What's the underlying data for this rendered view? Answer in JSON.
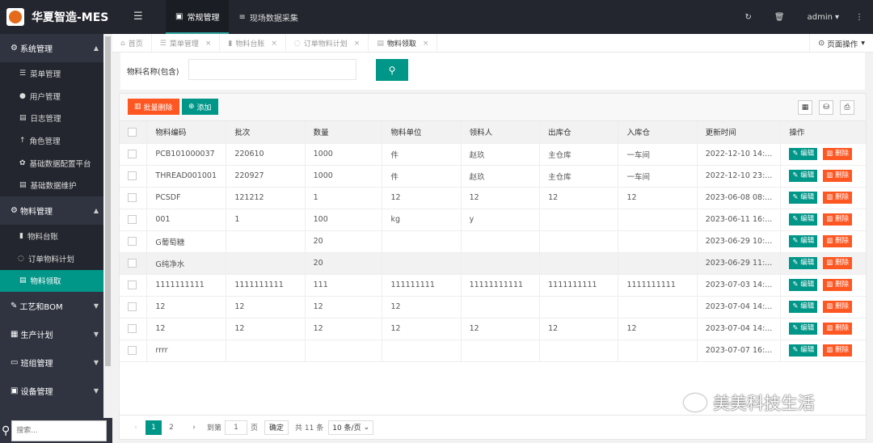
{
  "app": {
    "title": "华夏智造-MES"
  },
  "topnav": [
    {
      "label": "常规管理",
      "active": true
    },
    {
      "label": "现场数据采集",
      "active": false
    }
  ],
  "user": {
    "name": "admin"
  },
  "sidebar": {
    "groups": [
      {
        "label": "系统管理",
        "open": true,
        "items": [
          {
            "label": "菜单管理"
          },
          {
            "label": "用户管理"
          },
          {
            "label": "日志管理"
          },
          {
            "label": "角色管理"
          },
          {
            "label": "基础数据配置平台"
          },
          {
            "label": "基础数据维护"
          }
        ]
      },
      {
        "label": "物料管理",
        "open": true,
        "items": [
          {
            "label": "物料台账"
          },
          {
            "label": "订单物料计划"
          },
          {
            "label": "物料领取",
            "active": true
          }
        ]
      },
      {
        "label": "工艺和BOM",
        "open": false,
        "items": []
      },
      {
        "label": "生产计划",
        "open": false,
        "items": []
      },
      {
        "label": "班组管理",
        "open": false,
        "items": []
      },
      {
        "label": "设备管理",
        "open": false,
        "items": []
      }
    ],
    "search_placeholder": "搜索..."
  },
  "tabs": [
    {
      "label": "首页",
      "closable": false
    },
    {
      "label": "菜单管理",
      "closable": true
    },
    {
      "label": "物料台账",
      "closable": true
    },
    {
      "label": "订单物料计划",
      "closable": true
    },
    {
      "label": "物料领取",
      "closable": true,
      "active": true
    }
  ],
  "page_ops": "页面操作",
  "search": {
    "label": "物料名称(包含)",
    "value": ""
  },
  "toolbar": {
    "batch_delete": "批量删除",
    "add": "添加"
  },
  "table": {
    "columns": [
      "物料编码",
      "批次",
      "数量",
      "物料单位",
      "领料人",
      "出库仓",
      "入库仓",
      "更新时间",
      "操作"
    ],
    "rows": [
      [
        "PCB101000037",
        "220610",
        "1000",
        "件",
        "赵玖",
        "主仓库",
        "一车间",
        "2022-12-10 14:..."
      ],
      [
        "THREAD001001",
        "220927",
        "1000",
        "件",
        "赵玖",
        "主仓库",
        "一车间",
        "2022-12-10 23:..."
      ],
      [
        "PCSDF",
        "121212",
        "1",
        "12",
        "12",
        "12",
        "12",
        "2023-06-08 08:..."
      ],
      [
        "001",
        "1",
        "100",
        "kg",
        "y",
        "",
        "",
        "2023-06-11 16:..."
      ],
      [
        "G葡萄糖",
        "",
        "20",
        "",
        "",
        "",
        "",
        "2023-06-29 10:..."
      ],
      [
        "G纯净水",
        "",
        "20",
        "",
        "",
        "",
        "",
        "2023-06-29 11:..."
      ],
      [
        "1111111111",
        "1111111111",
        "111",
        "111111111",
        "11111111111",
        "1111111111",
        "1111111111",
        "2023-07-03 14:..."
      ],
      [
        "12",
        "12",
        "12",
        "12",
        "",
        "",
        "",
        "2023-07-04 14:..."
      ],
      [
        "12",
        "12",
        "12",
        "12",
        "12",
        "12",
        "12",
        "2023-07-04 14:..."
      ],
      [
        "rrrr",
        "",
        "",
        "",
        "",
        "",
        "",
        "2023-07-07 16:..."
      ]
    ],
    "edit_label": "编辑",
    "delete_label": "删除"
  },
  "pager": {
    "pages": [
      "1",
      "2"
    ],
    "goto_label": "到第",
    "page_value": "1",
    "page_unit": "页",
    "confirm": "确定",
    "total": "共 11 条",
    "page_size": "10 条/页"
  },
  "watermark": "美美科技生活",
  "colors": {
    "primary": "#009688",
    "danger": "#ff5722",
    "header_bg": "#23262e",
    "sidebar_bg": "#2f3440"
  }
}
